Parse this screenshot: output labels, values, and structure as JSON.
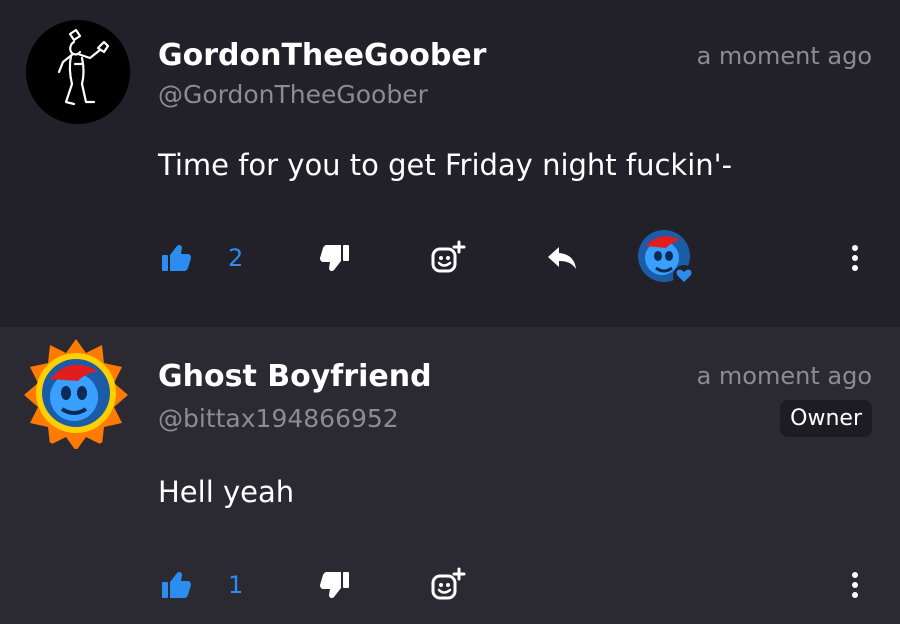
{
  "comments": [
    {
      "author": "GordonTheeGoober",
      "handle": "@GordonTheeGoober",
      "time": "a moment ago",
      "text": "Time for you to get Friday night fuckin'-",
      "likes": "2",
      "creator_heart": true
    },
    {
      "author": "Ghost Boyfriend",
      "handle": "@bittax194866952",
      "time": "a moment ago",
      "badge": "Owner",
      "text": "Hell yeah",
      "likes": "1"
    }
  ],
  "colors": {
    "background": "#222029",
    "highlight_background": "#2b2932",
    "accent": "#2d8cf0",
    "muted_text": "#8c8a93"
  },
  "icons": [
    "thumbs-up-icon",
    "thumbs-down-icon",
    "add-reaction-icon",
    "reply-icon",
    "more-vertical-icon",
    "heart-icon"
  ]
}
